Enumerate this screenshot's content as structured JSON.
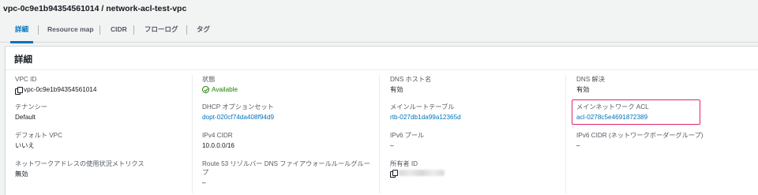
{
  "page": {
    "title": "vpc-0c9e1b94354561014 / network-acl-test-vpc"
  },
  "tabs": [
    {
      "label": "詳細",
      "active": true
    },
    {
      "label": "Resource map"
    },
    {
      "label": "CIDR"
    },
    {
      "label": "フローログ"
    },
    {
      "label": "タグ"
    }
  ],
  "panel": {
    "title": "詳細"
  },
  "details": {
    "vpc_id": {
      "label": "VPC ID",
      "value": "vpc-0c9e1b94354561014",
      "icon": "copy-icon"
    },
    "state": {
      "label": "状態",
      "value": "Available",
      "icon": "check-circle-icon",
      "color": "#1d8102"
    },
    "dns_hostnames": {
      "label": "DNS ホスト名",
      "value": "有効"
    },
    "dns_resolution": {
      "label": "DNS 解決",
      "value": "有効"
    },
    "tenancy": {
      "label": "テナンシー",
      "value": "Default"
    },
    "dhcp_options": {
      "label": "DHCP オプションセット",
      "value": "dopt-020cf74da408f94d9"
    },
    "main_route_table": {
      "label": "メインルートテーブル",
      "value": "rtb-027db1da99a12365d"
    },
    "main_network_acl": {
      "label": "メインネットワーク ACL",
      "value": "acl-0278c5e4691872389",
      "highlighted": true
    },
    "default_vpc": {
      "label": "デフォルト VPC",
      "value": "いいえ"
    },
    "ipv4_cidr": {
      "label": "IPv4 CIDR",
      "value": "10.0.0.0/16"
    },
    "ipv6_pool": {
      "label": "IPv6 プール",
      "value": "–"
    },
    "ipv6_cidr": {
      "label": "IPv6 CIDR (ネットワークボーダーグループ)",
      "value": "–"
    },
    "network_address_metrics": {
      "label": "ネットワークアドレスの使用状況メトリクス",
      "value": "無効"
    },
    "route53_resolver": {
      "label": "Route 53 リゾルバー DNS ファイアウォールルールグループ",
      "value": "–"
    },
    "owner_id": {
      "label": "所有者 ID",
      "icon": "copy-icon"
    }
  },
  "colors": {
    "link": "#0073bb",
    "available": "#1d8102",
    "highlight": "#e0246b"
  }
}
